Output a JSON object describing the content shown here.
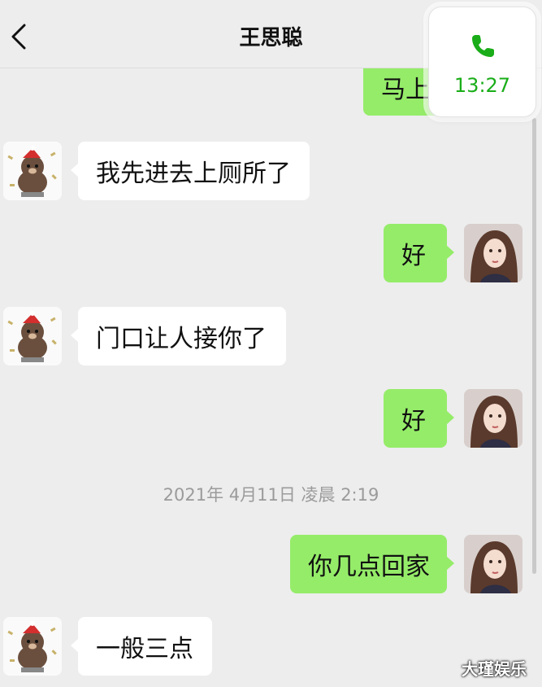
{
  "header": {
    "title": "王思聪"
  },
  "call": {
    "time": "13:27"
  },
  "messages": [
    {
      "side": "right",
      "text": "马上"
    },
    {
      "side": "left",
      "text": "我先进去上厕所了"
    },
    {
      "side": "right",
      "text": "好"
    },
    {
      "side": "left",
      "text": "门口让人接你了"
    },
    {
      "side": "right",
      "text": "好"
    },
    {
      "side": "right",
      "text": "你几点回家"
    },
    {
      "side": "left",
      "text": "一般三点"
    }
  ],
  "timestamp": "2021年 4月11日 凌晨 2:19",
  "watermark": "大瑾娱乐",
  "colors": {
    "green_bubble": "#95ec69",
    "accent": "#1aad19",
    "background": "#ededed"
  }
}
